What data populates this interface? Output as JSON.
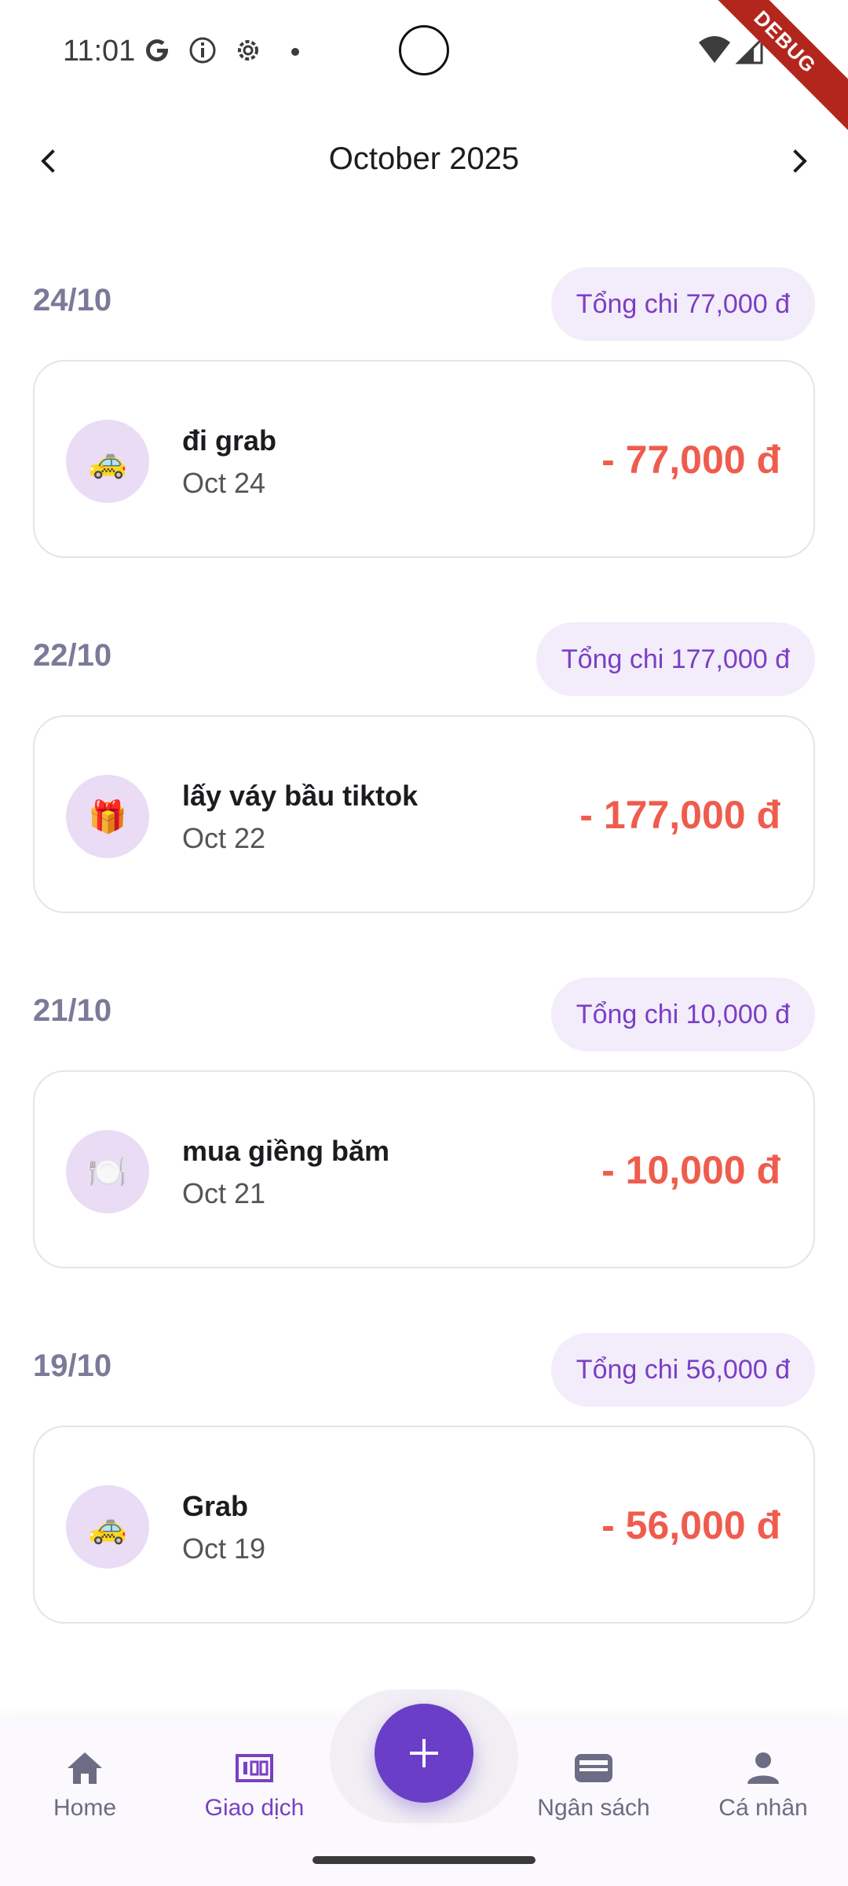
{
  "status_bar": {
    "time": "11:01",
    "icons": [
      "google-icon",
      "info-icon",
      "settings-icon",
      "dot-icon",
      "wifi-icon",
      "signal-icon"
    ],
    "debug_label": "DEBUG"
  },
  "header": {
    "month_title": "October 2025",
    "prev_icon": "chevron-left-icon",
    "next_icon": "chevron-right-icon"
  },
  "groups": [
    {
      "date": "24/10",
      "total": "Tổng chi 77,000 đ",
      "transaction": {
        "icon": "taxi-icon",
        "emoji": "🚕",
        "name": "đi grab",
        "date": "Oct 24",
        "amount": "- 77,000 đ"
      }
    },
    {
      "date": "22/10",
      "total": "Tổng chi 177,000 đ",
      "transaction": {
        "icon": "gift-icon",
        "emoji": "🎁",
        "name": "lấy váy bầu tiktok",
        "date": "Oct 22",
        "amount": "- 177,000 đ"
      }
    },
    {
      "date": "21/10",
      "total": "Tổng chi 10,000 đ",
      "transaction": {
        "icon": "plate-icon",
        "emoji": "🍽️",
        "name": "mua giềng băm",
        "date": "Oct 21",
        "amount": "- 10,000 đ"
      }
    },
    {
      "date": "19/10",
      "total": "Tổng chi 56,000 đ",
      "transaction": {
        "icon": "taxi-icon",
        "emoji": "🚕",
        "name": "Grab",
        "date": "Oct 19",
        "amount": "- 56,000 đ"
      }
    }
  ],
  "bottom_nav": {
    "items": [
      {
        "label": "Home",
        "icon": "home-icon",
        "active": false
      },
      {
        "label": "Giao dịch",
        "icon": "transactions-icon",
        "active": true
      },
      {
        "label": "Ngân sách",
        "icon": "wallet-icon",
        "active": false
      },
      {
        "label": "Cá nhân",
        "icon": "person-icon",
        "active": false
      }
    ],
    "fab_icon": "plus-icon"
  },
  "colors": {
    "accent": "#7a3fc2",
    "fab": "#6a3ec7",
    "expense": "#ef5c4d",
    "chip_bg": "#f3ecfb",
    "icon_bg": "#eadcf5"
  }
}
